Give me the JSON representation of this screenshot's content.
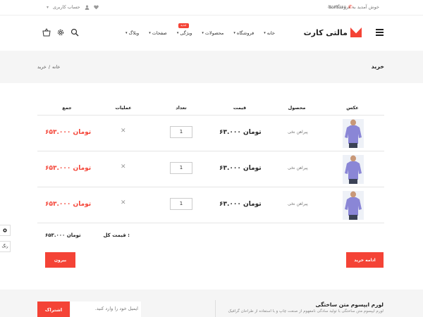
{
  "topbar": {
    "welcome": "خوش آمدید به فروشگاه ما",
    "phone": "۰۳۵۳۶۶۶۵",
    "account": "حساب کاربری"
  },
  "header": {
    "logo_text": "مالتی کارت",
    "nav": [
      {
        "label": "خانه"
      },
      {
        "label": "فروشگاه"
      },
      {
        "label": "محصولات"
      },
      {
        "label": "ویژگی",
        "badge": "جدید"
      },
      {
        "label": "صفحات"
      },
      {
        "label": "وبلاگ"
      }
    ],
    "icons": [
      "menu-icon",
      "search-icon",
      "gear-icon",
      "basket-icon"
    ]
  },
  "page": {
    "title": "خرید",
    "breadcrumb": [
      "خانه",
      "/",
      "خرید"
    ]
  },
  "cart": {
    "columns": [
      "عکس",
      "محصول",
      "قیمت",
      "تعداد",
      "عملیات",
      "جمع"
    ],
    "rows": [
      {
        "product": "پیراهن نخی",
        "price": "۶۳.۰۰۰ تومان",
        "qty": "1",
        "total": "۶۵۳.۰۰۰ تومان"
      },
      {
        "product": "پیراهن نخی",
        "price": "۶۳.۰۰۰ تومان",
        "qty": "1",
        "total": "۶۵۳.۰۰۰ تومان"
      },
      {
        "product": "پیراهن نخی",
        "price": "۶۳.۰۰۰ تومان",
        "qty": "1",
        "total": "۶۵۳.۰۰۰ تومان"
      }
    ],
    "grand_label": "قیمت کل :",
    "grand_value": "۶۵۳.۰۰۰ تومان",
    "checkout_label": "بیرون",
    "continue_label": "ادامه خرید"
  },
  "side": {
    "color_label": "رنگ"
  },
  "footer": {
    "newsletter_title": "لورم ایپسوم متن ساختگی",
    "newsletter_desc": "لورم ایپسوم متن ساختگی با تولید سادگی نامفهوم از صنعت چاپ و با استفاده از طراحان گرافیک",
    "email_placeholder": "ایمیل خود را وارد کنید.",
    "subscribe_label": "اشتراک"
  },
  "colors": {
    "accent": "#f44336",
    "titlebar_bg": "#f5f5f5"
  }
}
